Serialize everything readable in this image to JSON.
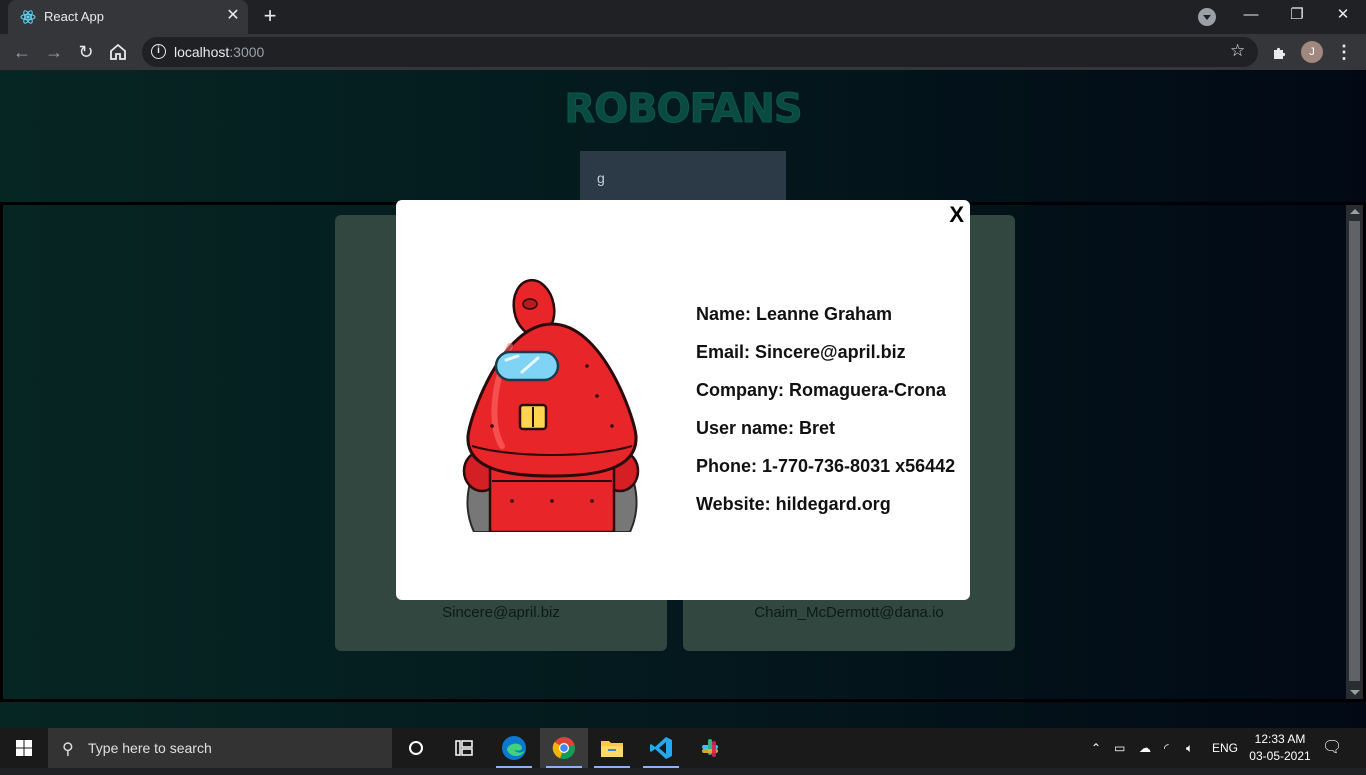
{
  "browser": {
    "tab_title": "React App",
    "tab_close": "✕",
    "new_tab": "+",
    "url_host": "localhost",
    "url_port": ":3000",
    "profile_initial": "J",
    "window_minimize": "—",
    "window_restore": "❐",
    "window_close": "✕"
  },
  "app": {
    "logo": "RoboFans",
    "search_value": "g"
  },
  "cards": [
    {
      "email": "Sincere@april.biz"
    },
    {
      "email": "Chaim_McDermott@dana.io"
    }
  ],
  "modal": {
    "close_label": "X",
    "details": [
      {
        "label": "Name: Leanne Graham"
      },
      {
        "label": "Email: Sincere@april.biz"
      },
      {
        "label": "Company: Romaguera-Crona"
      },
      {
        "label": "User name: Bret"
      },
      {
        "label": "Phone: 1-770-736-8031 x56442"
      },
      {
        "label": "Website: hildegard.org"
      }
    ]
  },
  "taskbar": {
    "search_placeholder": "Type here to search",
    "language": "ENG",
    "time": "12:33 AM",
    "date": "03-05-2021"
  },
  "colors": {
    "page_bg_left": "#062623",
    "page_bg_right": "#020915",
    "card_bg": "#31473f",
    "robot_red": "#e8262a"
  }
}
